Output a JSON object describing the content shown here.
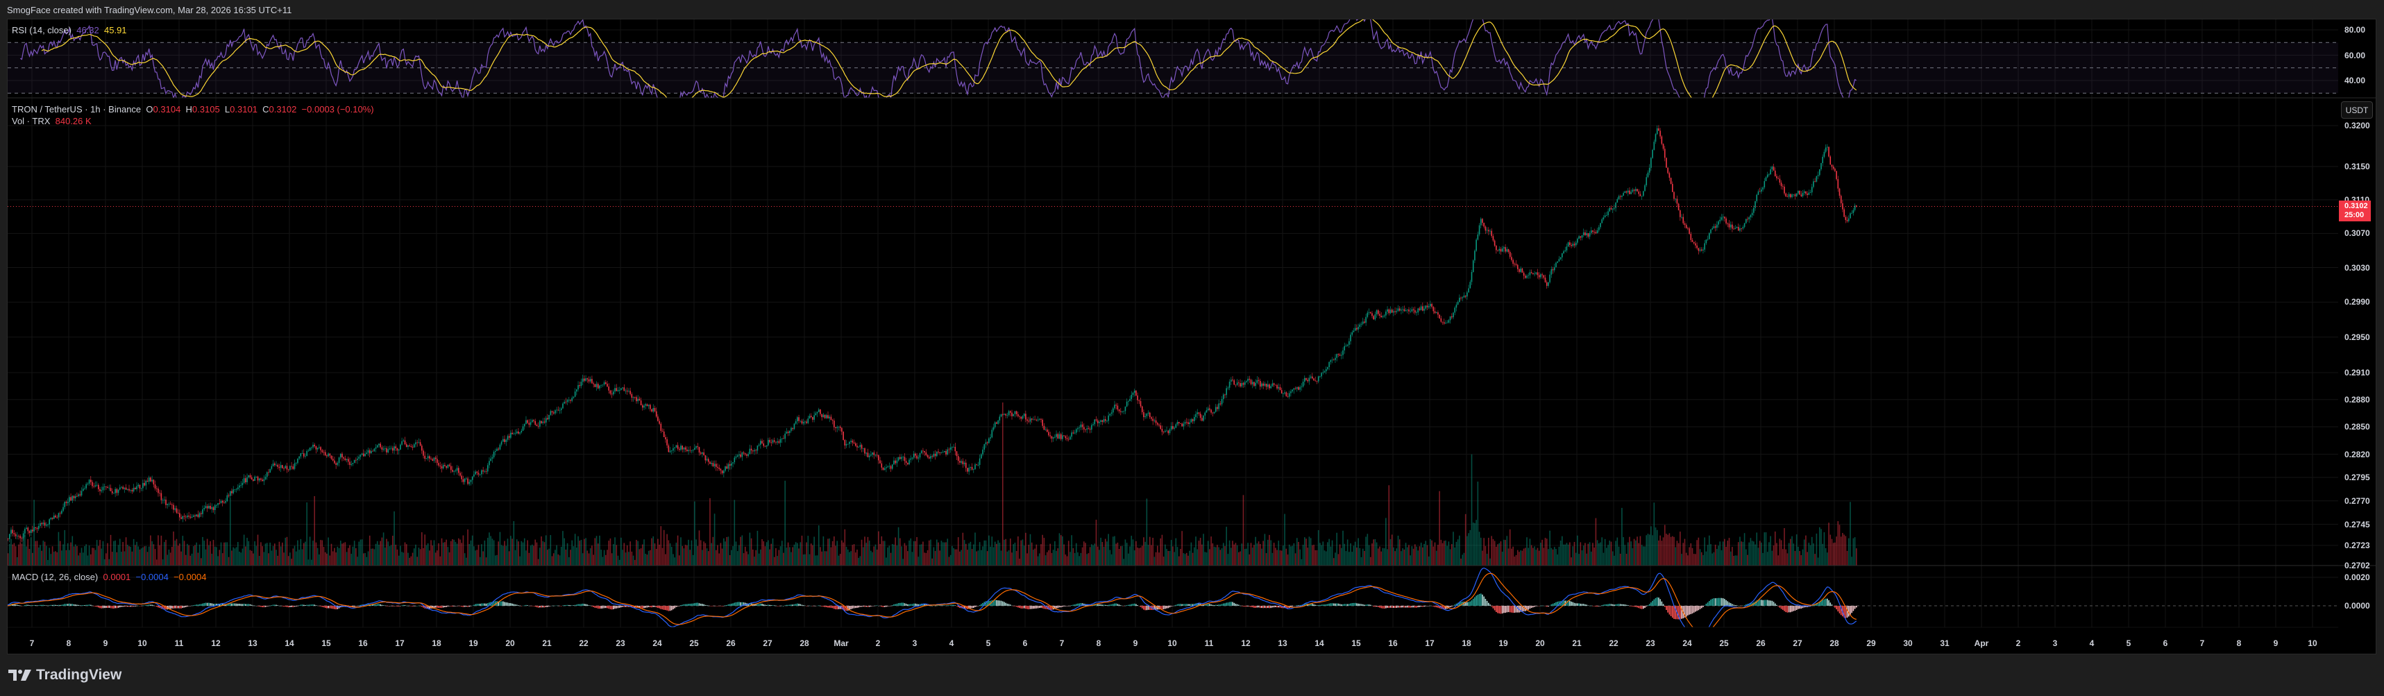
{
  "header": {
    "text": "SmogFace created with TradingView.com, Mar 28, 2026 16:35 UTC+11"
  },
  "rsi_legend": {
    "title": "RSI (14, close)",
    "rsi_value": "46.32",
    "ma_value": "45.91"
  },
  "main_legend": {
    "symbol": "TRON / TetherUS · 1h · Binance",
    "o_label": "O",
    "o_value": "0.3104",
    "h_label": "H",
    "h_value": "0.3105",
    "l_label": "L",
    "l_value": "0.3101",
    "c_label": "C",
    "c_value": "0.3102",
    "change": "−0.0003 (−0.10%)",
    "vol_label": "Vol · TRX",
    "vol_value": "840.26 K"
  },
  "macd_legend": {
    "title": "MACD (12, 26, close)",
    "hist_value": "0.0001",
    "macd_value": "−0.0004",
    "signal_value": "−0.0004"
  },
  "price_axis": {
    "currency_button": "USDT",
    "ticks": [
      "0.3200",
      "0.3150",
      "0.3110",
      "0.3070",
      "0.3030",
      "0.2990",
      "0.2950",
      "0.2910",
      "0.2880",
      "0.2850",
      "0.2820",
      "0.2795",
      "0.2770",
      "0.2745",
      "0.2723",
      "0.2702"
    ],
    "current_price": "0.3102",
    "countdown": "25:00"
  },
  "rsi_axis": {
    "ticks": [
      "80.00",
      "60.00",
      "40.00"
    ]
  },
  "macd_axis": {
    "ticks": [
      "0.0020",
      "0.0000"
    ]
  },
  "time_axis": {
    "labels": [
      "7",
      "8",
      "9",
      "10",
      "11",
      "12",
      "13",
      "14",
      "15",
      "16",
      "17",
      "18",
      "19",
      "20",
      "21",
      "22",
      "23",
      "24",
      "25",
      "26",
      "27",
      "28",
      "Mar",
      "2",
      "3",
      "4",
      "5",
      "6",
      "7",
      "8",
      "9",
      "10",
      "11",
      "12",
      "13",
      "14",
      "15",
      "16",
      "17",
      "18",
      "19",
      "20",
      "21",
      "22",
      "23",
      "24",
      "25",
      "26",
      "27",
      "28",
      "29",
      "30",
      "31",
      "Apr",
      "2",
      "3",
      "4",
      "5",
      "6",
      "7",
      "8",
      "9",
      "10"
    ]
  },
  "logo": {
    "text": "TradingView"
  },
  "colors": {
    "up": "#089981",
    "down": "#f23645",
    "rsi": "#7e57c2",
    "rsi_ma": "#fdd835",
    "macd": "#2962ff",
    "signal": "#ff6d00"
  },
  "chart_data": {
    "type": "candlestick",
    "title": "TRON / TetherUS · 1h · Binance",
    "interval": "1h",
    "x_unit": "days since Feb 7",
    "price_scale": "log",
    "ylim": [
      0.2702,
      0.32
    ],
    "price_path": [
      [
        -0.9,
        0.273
      ],
      [
        0.37,
        0.2746
      ],
      [
        1.6,
        0.2789
      ],
      [
        2.4,
        0.278
      ],
      [
        3.3,
        0.279
      ],
      [
        3.8,
        0.2754
      ],
      [
        4.5,
        0.275
      ],
      [
        5.95,
        0.2793
      ],
      [
        6.8,
        0.2802
      ],
      [
        7.8,
        0.2829
      ],
      [
        8.9,
        0.2814
      ],
      [
        10.3,
        0.2832
      ],
      [
        11.9,
        0.279
      ],
      [
        13.2,
        0.2846
      ],
      [
        14.0,
        0.286
      ],
      [
        15.0,
        0.2897
      ],
      [
        16.1,
        0.2885
      ],
      [
        16.9,
        0.287
      ],
      [
        17.3,
        0.2821
      ],
      [
        18.1,
        0.2829
      ],
      [
        18.8,
        0.28
      ],
      [
        19.8,
        0.2836
      ],
      [
        20.9,
        0.2855
      ],
      [
        21.7,
        0.2866
      ],
      [
        22.1,
        0.2832
      ],
      [
        22.7,
        0.282
      ],
      [
        23.3,
        0.2808
      ],
      [
        24.0,
        0.2816
      ],
      [
        25.0,
        0.2825
      ],
      [
        25.6,
        0.2803
      ],
      [
        26.4,
        0.287
      ],
      [
        27.4,
        0.2851
      ],
      [
        28.1,
        0.2838
      ],
      [
        28.9,
        0.2855
      ],
      [
        30.0,
        0.2882
      ],
      [
        30.8,
        0.2838
      ],
      [
        31.4,
        0.285
      ],
      [
        32.2,
        0.287
      ],
      [
        32.6,
        0.2902
      ],
      [
        33.4,
        0.2893
      ],
      [
        34.2,
        0.2888
      ],
      [
        34.9,
        0.2905
      ],
      [
        35.5,
        0.2936
      ],
      [
        36.3,
        0.2974
      ],
      [
        37.2,
        0.298
      ],
      [
        38.0,
        0.298
      ],
      [
        38.4,
        0.2963
      ],
      [
        39.0,
        0.2997
      ],
      [
        39.4,
        0.3086
      ],
      [
        39.8,
        0.306
      ],
      [
        40.5,
        0.3032
      ],
      [
        41.2,
        0.3015
      ],
      [
        41.6,
        0.305
      ],
      [
        42.4,
        0.3068
      ],
      [
        43.2,
        0.3113
      ],
      [
        43.8,
        0.3123
      ],
      [
        44.2,
        0.319
      ],
      [
        44.6,
        0.3113
      ],
      [
        45.0,
        0.3075
      ],
      [
        45.3,
        0.305
      ],
      [
        45.9,
        0.3086
      ],
      [
        46.5,
        0.3072
      ],
      [
        47.3,
        0.315
      ],
      [
        47.7,
        0.3113
      ],
      [
        48.3,
        0.3113
      ],
      [
        48.8,
        0.3168
      ],
      [
        49.3,
        0.3095
      ],
      [
        49.6,
        0.3102
      ]
    ],
    "volume_spike_day": 26.4,
    "indicators": {
      "rsi_period": 14,
      "rsi_ma_period": 14,
      "macd": [
        12,
        26,
        9
      ],
      "rsi_bands": [
        70,
        50,
        30
      ]
    }
  }
}
